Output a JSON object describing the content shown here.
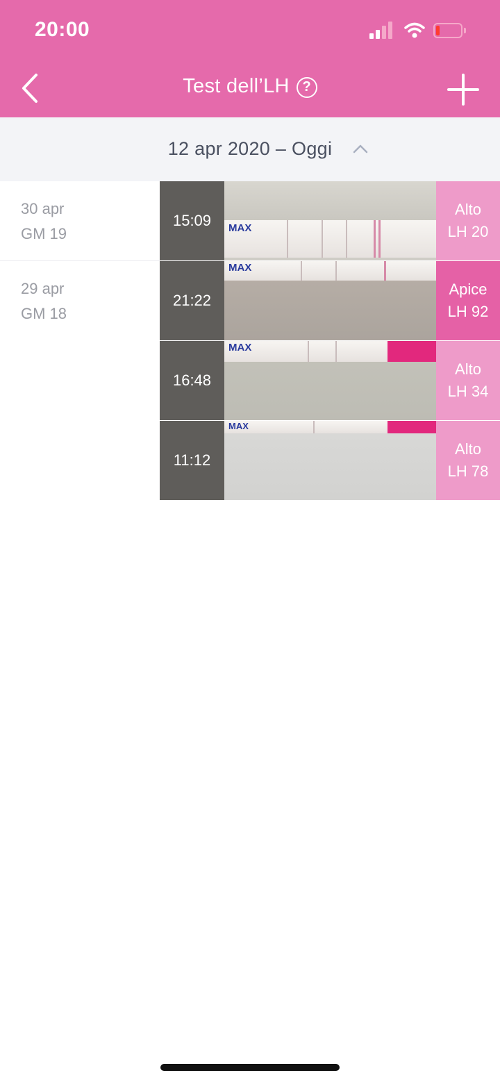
{
  "status_bar": {
    "time": "20:00"
  },
  "nav": {
    "title": "Test dell’LH",
    "help_symbol": "?"
  },
  "range": {
    "label": "12 apr 2020 – Oggi"
  },
  "colors": {
    "header": "#e56aab",
    "peak": "#e561a6",
    "high": "#ee9bc9"
  },
  "days": [
    {
      "date": "30 apr",
      "cycle_day": "GM 19"
    },
    {
      "date": "29 apr",
      "cycle_day": "GM 18"
    }
  ],
  "tests": [
    {
      "time": "15:09",
      "level": "Alto",
      "lh": "LH 20",
      "strip_text": "MAX"
    },
    {
      "time": "21:22",
      "level": "Apice",
      "lh": "LH 92",
      "strip_text": "MAX"
    },
    {
      "time": "16:48",
      "level": "Alto",
      "lh": "LH 34",
      "strip_text": "MAX"
    },
    {
      "time": "11:12",
      "level": "Alto",
      "lh": "LH 78",
      "strip_text": "MAX"
    }
  ]
}
